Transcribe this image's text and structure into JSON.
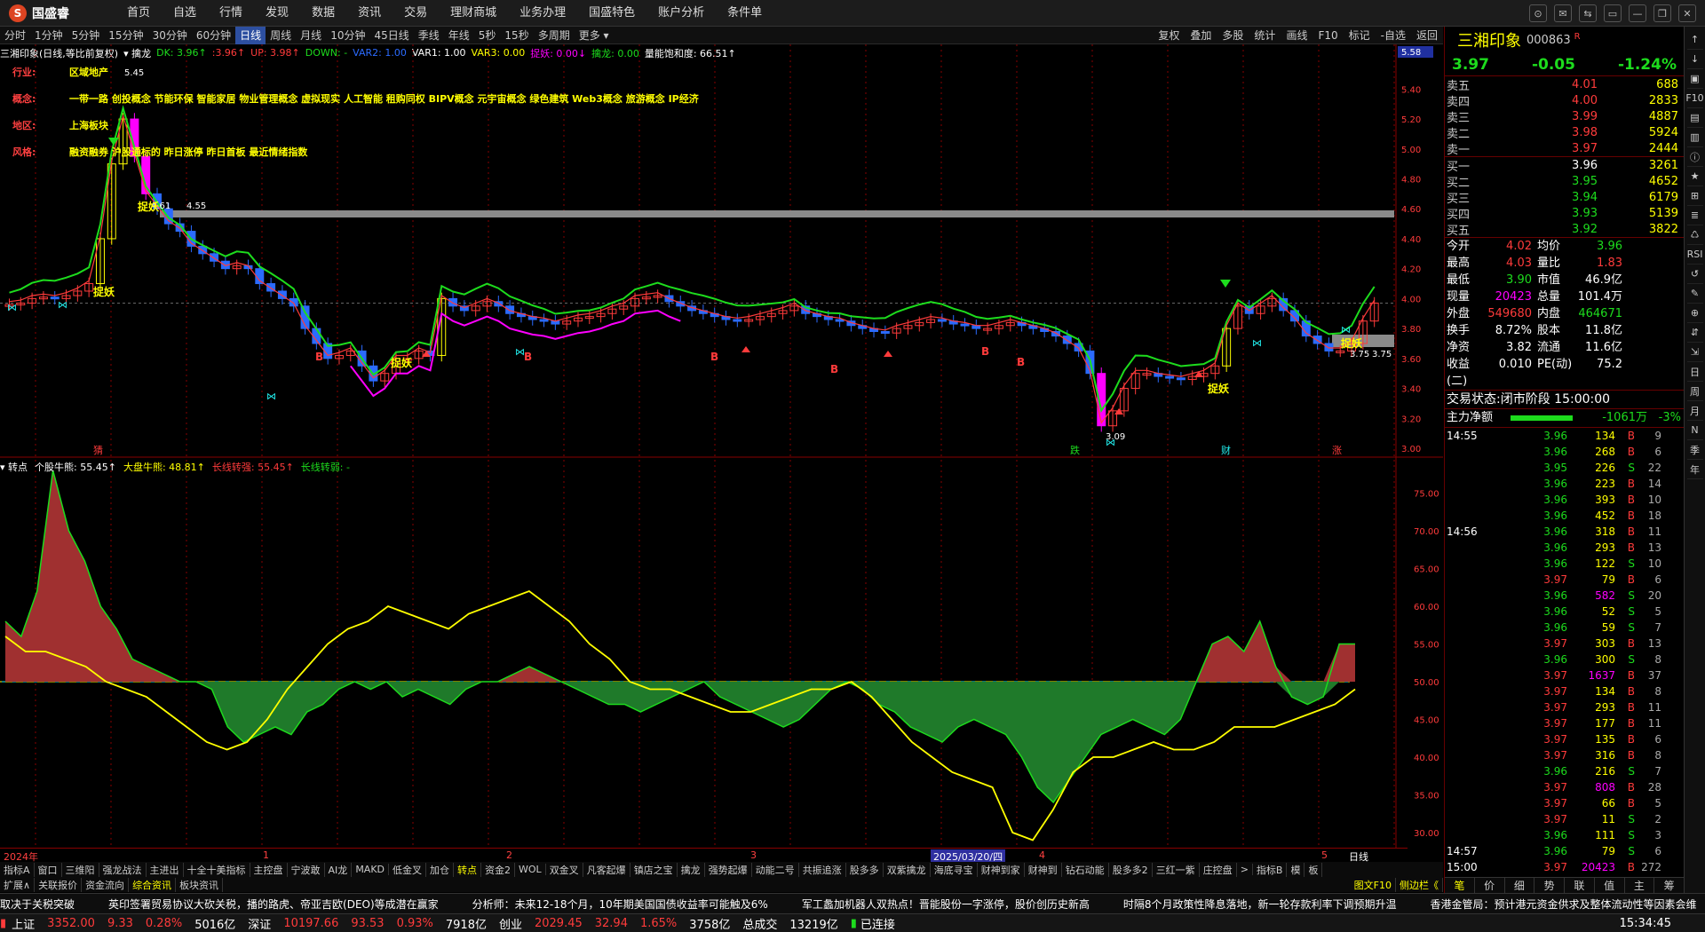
{
  "app": {
    "logo": "国盛睿",
    "menu": [
      "首页",
      "自选",
      "行情",
      "发现",
      "数据",
      "资讯",
      "交易",
      "理财商城",
      "业务办理",
      "国盛特色",
      "账户分析",
      "条件单"
    ],
    "window_controls": [
      "⊙",
      "✉",
      "⇆",
      "▭",
      "—",
      "❐",
      "✕"
    ]
  },
  "periods": {
    "items": [
      "分时",
      "1分钟",
      "5分钟",
      "15分钟",
      "30分钟",
      "60分钟",
      "日线",
      "周线",
      "月线",
      "10分钟",
      "45日线",
      "季线",
      "年线",
      "5秒",
      "15秒",
      "多周期",
      "更多 ▾"
    ],
    "active": "日线",
    "tools": [
      "复权",
      "叠加",
      "多股",
      "统计",
      "画线",
      "F10",
      "标记",
      "-自选",
      "返回"
    ]
  },
  "main_legend": [
    {
      "t": "三湘印象(日线,等比前复权)",
      "c": "#fff"
    },
    {
      "t": "▾ 擒龙",
      "c": "#fff"
    },
    {
      "t": "DK: 3.96↑",
      "c": "#1ddc1d"
    },
    {
      "t": ":3.96↑",
      "c": "#ff3b3b"
    },
    {
      "t": "UP: 3.98↑",
      "c": "#ff3b3b"
    },
    {
      "t": "DOWN: -",
      "c": "#1ddc1d"
    },
    {
      "t": "VAR2: 1.00",
      "c": "#2b6bff"
    },
    {
      "t": "VAR1: 1.00",
      "c": "#fff"
    },
    {
      "t": "VAR3: 0.00",
      "c": "#ff0"
    },
    {
      "t": "捉妖: 0.00↓",
      "c": "#f0f"
    },
    {
      "t": "擒龙: 0.00",
      "c": "#1ddc1d"
    },
    {
      "t": "量能饱和度: 66.51↑",
      "c": "#fff"
    }
  ],
  "stock_info": [
    {
      "k": "行业:",
      "v": "区域地产"
    },
    {
      "k": "概念:",
      "v": "一带一路 创投概念 节能环保 智能家居 物业管理概念 虚拟现实 人工智能 租购同权 BIPV概念 元宇宙概念 绿色建筑 Web3概念 旅游概念 IP经济"
    },
    {
      "k": "地区:",
      "v": "上海板块"
    },
    {
      "k": "风格:",
      "v": "融资融券 沪股通标的 昨日涨停 昨日首板 最近情绪指数"
    }
  ],
  "price_axis": [
    "5.58",
    "5.40",
    "5.20",
    "5.00",
    "4.80",
    "4.60",
    "4.40",
    "4.20",
    "4.00",
    "3.80",
    "3.60",
    "3.40",
    "3.20",
    "3.00"
  ],
  "price_annotations": [
    "5.45",
    "4.61",
    "4.55",
    "3.75",
    "3.75",
    "3.09"
  ],
  "candle_labels": [
    "捉妖",
    "捉妖",
    "捉妖",
    "捉妖",
    "捉妖",
    "B",
    "B",
    "B",
    "B",
    "B",
    "B"
  ],
  "bottom_marks": [
    "猜",
    "跌",
    "财",
    "涨"
  ],
  "ind_legend": [
    {
      "t": "▾ 转点",
      "c": "#fff"
    },
    {
      "t": "个股牛熊: 55.45↑",
      "c": "#fff"
    },
    {
      "t": "大盘牛熊: 48.81↑",
      "c": "#ff0"
    },
    {
      "t": "长线转强: 55.45↑",
      "c": "#ff3b3b"
    },
    {
      "t": "长线转弱: -",
      "c": "#1ddc1d"
    }
  ],
  "ind_axis": [
    "75.00",
    "70.00",
    "65.00",
    "60.00",
    "55.00",
    "50.00",
    "45.00",
    "40.00",
    "35.00",
    "30.00"
  ],
  "xaxis": {
    "labels": [
      "2024年",
      "1",
      "2",
      "3",
      "2025/03/20/四",
      "4",
      "5"
    ],
    "period_label": "日线"
  },
  "indicator_tabs": [
    "指标A",
    "窗口",
    "三维阳",
    "强龙战法",
    "主进出",
    "十全十美指标",
    "主控盘",
    "宁波敢",
    "AI龙",
    "MAKD",
    "低金叉",
    "加仓",
    "转点",
    "资金2",
    "WOL",
    "双金叉",
    "凡客起爆",
    "镇店之宝",
    "擒龙",
    "强势起爆",
    "动能二号",
    "共振追涨",
    "股多多",
    "双紫擒龙",
    "海底寻宝",
    "财神到家",
    "财神到",
    "钻石动能",
    "股多多2",
    "三红一紫",
    "庄控盘",
    ">",
    "指标B",
    "模",
    "板"
  ],
  "indicator_active": "转点",
  "info_tabs": [
    "扩展∧",
    "关联报价",
    "资金流向",
    "综合资讯",
    "板块资讯"
  ],
  "info_active": "综合资讯",
  "info_right": [
    "图文F10",
    "侧边栏《"
  ],
  "ticker": [
    "取决于关税突破",
    "英印签署贸易协议大砍关税，播的路虎、帝亚吉欧(DEO)等成潜在赢家",
    "分析师：未来12-18个月，10年期美国国债收益率可能触及6%",
    "军工蠡加机器人双热点！晋能股份一字涨停，股价创历史新高",
    "时隔8个月政策性降息落地，新一轮存款利率下调预期升温",
    "香港金管局：预计港元资金供求及整体流动性等因素会维"
  ],
  "status": {
    "sh": "上证",
    "sh_v": "3352.00",
    "sh_c": "9.33",
    "sh_p": "0.28%",
    "sh_a": "5016亿",
    "sz": "深证",
    "sz_v": "10197.66",
    "sz_c": "93.53",
    "sz_p": "0.93%",
    "sz_a": "7918亿",
    "cy": "创业",
    "cy_v": "2029.45",
    "cy_c": "32.94",
    "cy_p": "1.65%",
    "cy_a": "3758亿",
    "tot": "总成交",
    "tot_v": "13219亿",
    "conn": "已连接",
    "time": "15:34:45"
  },
  "quote": {
    "name": "三湘印象",
    "code": "000863",
    "tag": "R",
    "price": "3.97",
    "change": "-0.05",
    "pct": "-1.24%",
    "asks": [
      {
        "l": "卖五",
        "p": "4.01",
        "v": "688"
      },
      {
        "l": "卖四",
        "p": "4.00",
        "v": "2833"
      },
      {
        "l": "卖三",
        "p": "3.99",
        "v": "4887"
      },
      {
        "l": "卖二",
        "p": "3.98",
        "v": "5924"
      },
      {
        "l": "卖一",
        "p": "3.97",
        "v": "2444"
      }
    ],
    "bids": [
      {
        "l": "买一",
        "p": "3.96",
        "v": "3261"
      },
      {
        "l": "买二",
        "p": "3.95",
        "v": "4652"
      },
      {
        "l": "买三",
        "p": "3.94",
        "v": "6179"
      },
      {
        "l": "买四",
        "p": "3.93",
        "v": "5139"
      },
      {
        "l": "买五",
        "p": "3.92",
        "v": "3822"
      }
    ],
    "stats": [
      [
        "今开",
        "4.02",
        "red",
        "均价",
        "3.96",
        "grn"
      ],
      [
        "最高",
        "4.03",
        "red",
        "量比",
        "1.83",
        "red"
      ],
      [
        "最低",
        "3.90",
        "grn",
        "市值",
        "46.9亿",
        "wht"
      ],
      [
        "现量",
        "20423",
        "mag",
        "总量",
        "101.4万",
        "wht"
      ],
      [
        "外盘",
        "549680",
        "red",
        "内盘",
        "464671",
        "grn"
      ],
      [
        "换手",
        "8.72%",
        "wht",
        "股本",
        "11.8亿",
        "wht"
      ],
      [
        "净资",
        "3.82",
        "wht",
        "流通",
        "11.6亿",
        "wht"
      ],
      [
        "收益(二)",
        "0.010",
        "wht",
        "PE(动)",
        "75.2",
        "wht"
      ]
    ],
    "trade_state": "交易状态:闭市阶段 15:00:00",
    "main_flow": {
      "label": "主力净额",
      "value": "-1061万",
      "pct": "-3%"
    }
  },
  "ticks": [
    [
      "14:55",
      "3.96",
      "134",
      "B",
      "9"
    ],
    [
      "",
      "3.96",
      "268",
      "B",
      "6"
    ],
    [
      "",
      "3.95",
      "226",
      "S",
      "22"
    ],
    [
      "",
      "3.96",
      "223",
      "B",
      "14"
    ],
    [
      "",
      "3.96",
      "393",
      "B",
      "10"
    ],
    [
      "",
      "3.96",
      "452",
      "B",
      "18"
    ],
    [
      "14:56",
      "3.96",
      "318",
      "B",
      "11"
    ],
    [
      "",
      "3.96",
      "293",
      "B",
      "13"
    ],
    [
      "",
      "3.96",
      "122",
      "S",
      "10"
    ],
    [
      "",
      "3.97",
      "79",
      "B",
      "6"
    ],
    [
      "",
      "3.96",
      "582",
      "S",
      "20"
    ],
    [
      "",
      "3.96",
      "52",
      "S",
      "5"
    ],
    [
      "",
      "3.96",
      "59",
      "S",
      "7"
    ],
    [
      "",
      "3.97",
      "303",
      "B",
      "13"
    ],
    [
      "",
      "3.96",
      "300",
      "S",
      "8"
    ],
    [
      "",
      "3.97",
      "1637",
      "B",
      "37"
    ],
    [
      "",
      "3.97",
      "134",
      "B",
      "8"
    ],
    [
      "",
      "3.97",
      "293",
      "B",
      "11"
    ],
    [
      "",
      "3.97",
      "177",
      "B",
      "11"
    ],
    [
      "",
      "3.97",
      "135",
      "B",
      "6"
    ],
    [
      "",
      "3.97",
      "316",
      "B",
      "8"
    ],
    [
      "",
      "3.96",
      "216",
      "S",
      "7"
    ],
    [
      "",
      "3.97",
      "808",
      "B",
      "28"
    ],
    [
      "",
      "3.97",
      "66",
      "B",
      "5"
    ],
    [
      "",
      "3.97",
      "11",
      "S",
      "2"
    ],
    [
      "",
      "3.96",
      "111",
      "S",
      "3"
    ],
    [
      "14:57",
      "3.96",
      "79",
      "S",
      "6"
    ],
    [
      "15:00",
      "3.97",
      "20423",
      "B",
      "272"
    ]
  ],
  "right_tabs": [
    "笔",
    "价",
    "细",
    "势",
    "联",
    "值",
    "主",
    "筹"
  ],
  "right_side": [
    "↑",
    "↓",
    "▣",
    "F10",
    "▤",
    "▥",
    "ⓘ",
    "★",
    "⊞",
    "≣",
    "♺",
    "RSI",
    "↺",
    "✎",
    "⊕",
    "⇵",
    "⇲",
    "日",
    "周",
    "月",
    "N",
    "季",
    "年"
  ],
  "colors": {
    "up": "#ff3b3b",
    "down": "#1ddc1d",
    "bg": "#000000",
    "grid": "#800000"
  },
  "chart_data": {
    "type": "candlestick",
    "price_range": [
      3.0,
      5.58
    ],
    "indicator_range": [
      28,
      78
    ],
    "indicator_baseline": 50,
    "closes": [
      3.96,
      3.97,
      4.0,
      4.01,
      4.0,
      4.02,
      4.05,
      4.1,
      4.4,
      4.9,
      5.2,
      4.95,
      4.7,
      4.6,
      4.5,
      4.45,
      4.35,
      4.3,
      4.25,
      4.2,
      4.22,
      4.2,
      4.1,
      4.05,
      4.0,
      3.95,
      3.8,
      3.7,
      3.6,
      3.62,
      3.65,
      3.55,
      3.45,
      3.5,
      3.6,
      3.6,
      3.65,
      3.62,
      4.0,
      3.95,
      3.92,
      3.95,
      3.98,
      3.95,
      3.9,
      3.88,
      3.86,
      3.85,
      3.83,
      3.85,
      3.87,
      3.88,
      3.9,
      3.93,
      3.95,
      4.0,
      4.01,
      4.02,
      3.98,
      3.95,
      3.92,
      3.9,
      3.88,
      3.86,
      3.85,
      3.86,
      3.88,
      3.9,
      3.92,
      3.95,
      3.9,
      3.88,
      3.86,
      3.85,
      3.82,
      3.8,
      3.78,
      3.77,
      3.8,
      3.82,
      3.84,
      3.86,
      3.85,
      3.83,
      3.82,
      3.8,
      3.8,
      3.82,
      3.84,
      3.82,
      3.8,
      3.78,
      3.75,
      3.7,
      3.65,
      3.5,
      3.15,
      3.25,
      3.4,
      3.5,
      3.5,
      3.48,
      3.47,
      3.46,
      3.48,
      3.5,
      3.55,
      3.8,
      3.95,
      3.9,
      3.95,
      4.0,
      3.92,
      3.85,
      3.75,
      3.7,
      3.65,
      3.65,
      3.7,
      3.85,
      3.97
    ],
    "indicator": [
      58,
      56,
      62,
      78,
      70,
      66,
      60,
      57,
      53,
      52,
      51,
      50,
      50,
      49,
      44,
      42,
      43,
      44,
      43,
      46,
      47,
      49,
      50,
      49,
      50,
      48,
      49,
      48,
      47,
      49,
      50,
      50,
      51,
      52,
      51,
      50,
      49,
      48,
      47,
      47,
      46,
      47,
      48,
      49,
      50,
      48,
      47,
      46,
      45,
      44,
      45,
      47,
      49,
      50,
      49,
      47,
      46,
      44,
      43,
      42,
      44,
      45,
      44,
      43,
      40,
      36,
      34,
      37,
      40,
      43,
      44,
      45,
      44,
      43,
      45,
      50,
      55,
      56,
      54,
      58,
      52,
      48,
      47,
      48,
      55,
      55
    ],
    "market": [
      56,
      54,
      54,
      53,
      52,
      50,
      49,
      48,
      46,
      44,
      42,
      41,
      42,
      45,
      49,
      52,
      55,
      57,
      58,
      60,
      59,
      58,
      57,
      59,
      60,
      61,
      62,
      60,
      58,
      55,
      53,
      50,
      49,
      49,
      48,
      47,
      46,
      46,
      47,
      48,
      49,
      49,
      50,
      48,
      45,
      42,
      40,
      38,
      37,
      36,
      30,
      29,
      33,
      38,
      40,
      40,
      41,
      42,
      41,
      41,
      42,
      44,
      44,
      44,
      45,
      46,
      47,
      49
    ],
    "x_labels": [
      "2024年",
      "1",
      "2",
      "3",
      "2025/03/20/四",
      "4",
      "5"
    ]
  }
}
